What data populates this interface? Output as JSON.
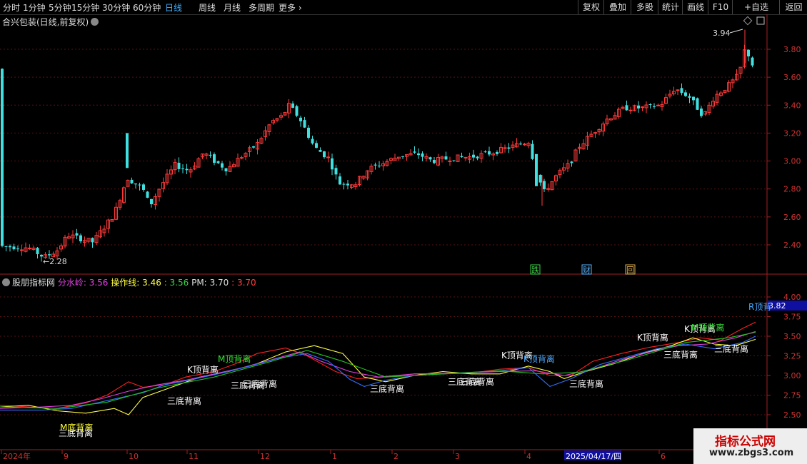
{
  "toolbar": {
    "periods": [
      "分时",
      "1分钟",
      "5分钟",
      "15分钟",
      "30分钟",
      "60分钟",
      "日线",
      "周线",
      "月线",
      "多周期",
      "更多"
    ],
    "active_period": "日线",
    "right_buttons": [
      "复权",
      "叠加",
      "多股",
      "统计",
      "画线",
      "F10",
      "+自选",
      "返回"
    ]
  },
  "main_chart": {
    "title": "合兴包装(日线,前复权)",
    "price_ticks": [
      "3.80",
      "3.60",
      "3.40",
      "3.20",
      "3.00",
      "2.80",
      "2.60",
      "2.40"
    ],
    "high_label": "3.94",
    "low_label": "2.28",
    "badges": [
      {
        "text": "跌",
        "color": "#3fd24a"
      },
      {
        "text": "财",
        "color": "#5bb4ff"
      },
      {
        "text": "回",
        "color": "#e0b050"
      }
    ]
  },
  "indicator": {
    "name": "股朋指标网",
    "label_fenshuiling": "分水岭:",
    "value_fenshuiling": "3.56",
    "label_caozuoxian": "操作线:",
    "value_caozuoxian": "3.46",
    "value_green": ": 3.56",
    "label_pm": "PM:",
    "value_pm": "3.70",
    "value_red": ": 3.70",
    "ticks": [
      "4.00",
      "3.75",
      "3.50",
      "3.25",
      "3.00",
      "2.75",
      "2.50"
    ],
    "current_value": "3.82",
    "current_label": "R顶背",
    "annotations": [
      {
        "text": "M底背离",
        "color": "#ffff30"
      },
      {
        "text": "三底背离",
        "color": "#ffffff"
      },
      {
        "text": "三底背离",
        "color": "#ffffff"
      },
      {
        "text": "K顶背离",
        "color": "#ffffff"
      },
      {
        "text": "M顶背离",
        "color": "#35e035"
      },
      {
        "text": "三底背离",
        "color": "#ffffff"
      },
      {
        "text": "三底背离",
        "color": "#ffffff"
      },
      {
        "text": "三底背离",
        "color": "#ffffff"
      },
      {
        "text": "三底背离",
        "color": "#ffffff"
      },
      {
        "text": "三底背离",
        "color": "#ffffff"
      },
      {
        "text": "K顶背离",
        "color": "#ffffff"
      },
      {
        "text": "K顶背离",
        "color": "#4aa8ff"
      },
      {
        "text": "三底背离",
        "color": "#ffffff"
      },
      {
        "text": "K顶背离",
        "color": "#ffffff"
      },
      {
        "text": "三底背离",
        "color": "#ffffff"
      },
      {
        "text": "K顶背离",
        "color": "#ffffff"
      },
      {
        "text": "M顶背离",
        "color": "#35e035"
      },
      {
        "text": "三底背离",
        "color": "#ffffff"
      }
    ]
  },
  "date_axis": {
    "labels": [
      "2024年",
      "9",
      "10",
      "11",
      "12",
      "1",
      "2",
      "3",
      "4",
      "2025/04/17/四",
      "6"
    ]
  },
  "watermark": {
    "line1": "指标公式网",
    "line2": "www.zbgs3.com"
  },
  "colors": {
    "up": "#ff3a3a",
    "down": "#40e0e0",
    "red_line": "#ff2020",
    "yellow_line": "#ffff40",
    "magenta_line": "#e040e0",
    "blue_line": "#3070ff",
    "green_line": "#20c020"
  }
}
